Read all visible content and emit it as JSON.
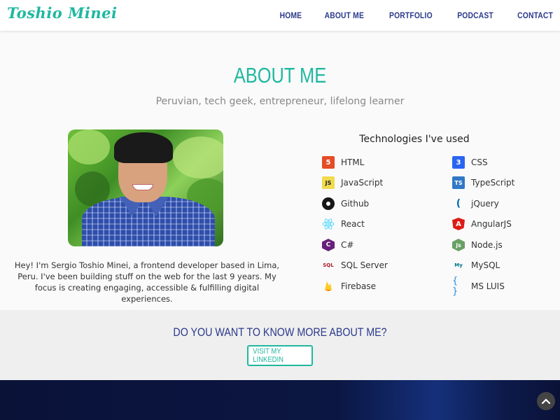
{
  "brand": "Toshio Minei",
  "nav": [
    "HOME",
    "ABOUT ME",
    "PORTFOLIO",
    "PODCAST",
    "CONTACT"
  ],
  "about": {
    "title": "ABOUT ME",
    "subtitle": "Peruvian, tech geek, entrepreneur, lifelong learner",
    "bio": "Hey! I'm Sergio Toshio Minei, a frontend developer based in Lima, Peru. I've been building stuff on the web for the last 9 years. My focus is creating engaging, accessible & fulfilling digital experiences."
  },
  "technologies": {
    "title": "Technologies I've used",
    "items": [
      {
        "label": "HTML",
        "icon": "html5-icon",
        "color": "#e44d26"
      },
      {
        "label": "CSS",
        "icon": "css3-icon",
        "color": "#2965f1"
      },
      {
        "label": "JavaScript",
        "icon": "javascript-icon",
        "color": "#f0db4f"
      },
      {
        "label": "TypeScript",
        "icon": "typescript-icon",
        "color": "#3178c6"
      },
      {
        "label": "Github",
        "icon": "github-icon",
        "color": "#181717"
      },
      {
        "label": "jQuery",
        "icon": "jquery-icon",
        "color": "#0769ad"
      },
      {
        "label": "React",
        "icon": "react-icon",
        "color": "#61dafb"
      },
      {
        "label": "AngularJS",
        "icon": "angular-icon",
        "color": "#dd1b16"
      },
      {
        "label": "C#",
        "icon": "csharp-icon",
        "color": "#68217a"
      },
      {
        "label": "Node.js",
        "icon": "nodejs-icon",
        "color": "#68a063"
      },
      {
        "label": "SQL Server",
        "icon": "sqlserver-icon",
        "color": "#a91d22"
      },
      {
        "label": "MySQL",
        "icon": "mysql-icon",
        "color": "#00758f"
      },
      {
        "label": "Firebase",
        "icon": "firebase-icon",
        "color": "#ffca28"
      },
      {
        "label": "MS LUIS",
        "icon": "braces-icon",
        "color": "#1e88e5"
      }
    ]
  },
  "cta": {
    "title": "DO YOU WANT TO KNOW MORE ABOUT ME?",
    "button": "VISIT MY LINKEDIN"
  },
  "colors": {
    "accent": "#1fb8a0",
    "navy": "#2b3a8c"
  }
}
